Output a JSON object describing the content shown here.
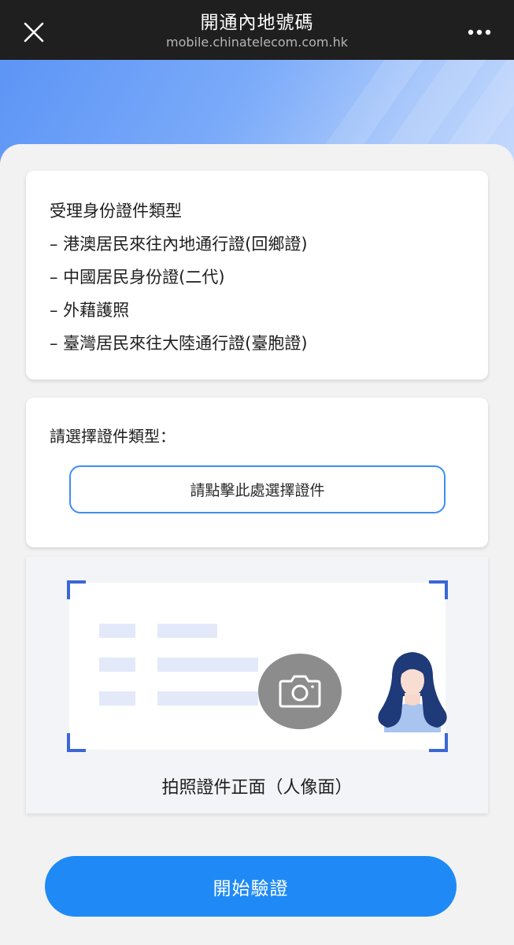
{
  "header": {
    "title": "開通內地號碼",
    "url": "mobile.chinatelecom.com.hk",
    "close_icon": "close-icon",
    "more_icon": "more-dots-icon"
  },
  "id_types": {
    "heading": "受理身份證件類型",
    "items": [
      "– 港澳居民來往內地通行證(回鄉證)",
      "– 中國居民身份證(二代)",
      "– 外藉護照",
      "– 臺灣居民來往大陸通行證(臺胞證)"
    ]
  },
  "select": {
    "label": "請選擇證件類型：",
    "button_label": "請點擊此處選擇證件"
  },
  "photo": {
    "caption": "拍照證件正面（人像面）",
    "camera_icon": "camera-icon"
  },
  "actions": {
    "start_label": "開始驗證"
  },
  "colors": {
    "accent": "#1f8af5",
    "frame_corner": "#3b66d6",
    "header_bg": "#1f1f1f"
  }
}
